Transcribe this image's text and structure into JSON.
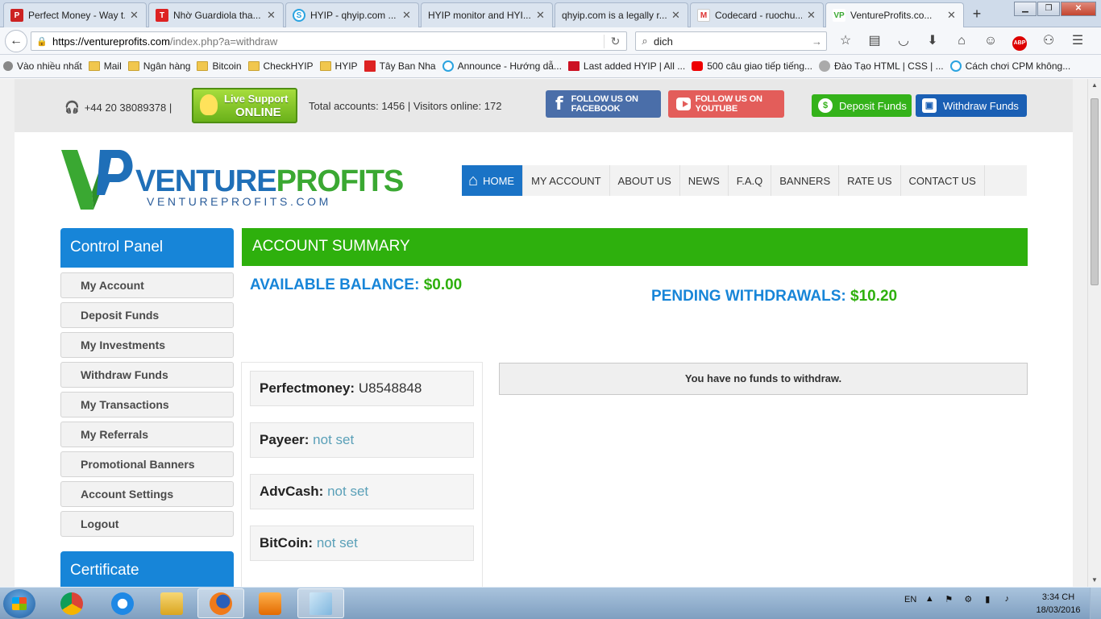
{
  "browser": {
    "tabs": [
      {
        "label": "Perfect Money - Way t...",
        "icon": "perfectmoney-icon"
      },
      {
        "label": "Nhờ Guardiola tha...",
        "icon": "news-t-icon"
      },
      {
        "label": "HYIP - qhyip.com ...",
        "icon": "qhyip-icon"
      },
      {
        "label": "HYIP monitor and HYI...",
        "icon": "blank-page-icon"
      },
      {
        "label": "qhyip.com is a legally r...",
        "icon": "blank-page-icon"
      },
      {
        "label": "Codecard - ruochu...",
        "icon": "gmail-icon"
      },
      {
        "label": "VentureProfits.co...",
        "icon": "ventureprofits-icon"
      }
    ],
    "url_host": "https://ventureprofits.com",
    "url_path": "/index.php?a=withdraw",
    "search_value": "dich",
    "bookmarks": [
      {
        "label": "Vào nhiều nhất",
        "icon": "gear-icon"
      },
      {
        "label": "Mail",
        "icon": "folder-icon"
      },
      {
        "label": "Ngân hàng",
        "icon": "folder-icon"
      },
      {
        "label": "Bitcoin",
        "icon": "folder-icon"
      },
      {
        "label": "CheckHYIP",
        "icon": "folder-icon"
      },
      {
        "label": "HYIP",
        "icon": "folder-icon"
      },
      {
        "label": "Tây Ban Nha",
        "icon": "news-t-icon"
      },
      {
        "label": "Announce - Hướng dẫ...",
        "icon": "cpm-icon"
      },
      {
        "label": "Last added HYIP | All ...",
        "icon": "a-icon"
      },
      {
        "label": "500 câu giao tiếp tiếng...",
        "icon": "youtube-icon"
      },
      {
        "label": "Đào Tạo HTML | CSS | ...",
        "icon": "globe-icon"
      },
      {
        "label": "Cách chơi CPM không...",
        "icon": "cpm-icon"
      }
    ]
  },
  "site": {
    "phone": "+44 20 38089378 |",
    "live_support": {
      "line1": "Live Support",
      "line2": "ONLINE"
    },
    "stats": "Total accounts:   1456 | Visitors online:   172",
    "facebook_label": "FOLLOW US ON FACEBOOK",
    "youtube_label": "FOLLOW US ON YOUTUBE",
    "deposit_label": "Deposit Funds",
    "withdraw_label": "Withdraw Funds",
    "logo": {
      "brand_a": "VENTURE",
      "brand_b": "PROFITS",
      "sub": "VENTUREPROFITS.COM"
    },
    "menu": [
      "HOME",
      "MY ACCOUNT",
      "ABOUT US",
      "NEWS",
      "F.A.Q",
      "BANNERS",
      "RATE US",
      "CONTACT US"
    ],
    "control_panel_title": "Control Panel",
    "sidebar": [
      "My Account",
      "Deposit Funds",
      "My Investments",
      "Withdraw Funds",
      "My Transactions",
      "My Referrals",
      "Promotional Banners",
      "Account Settings",
      "Logout"
    ],
    "certificate_title": "Certificate",
    "account_summary_title": "ACCOUNT SUMMARY",
    "available_balance_label": "AVAILABLE BALANCE:",
    "available_balance_value": "$0.00",
    "pending_label": "PENDING WITHDRAWALS:",
    "pending_value": "$10.20",
    "wallets": [
      {
        "label": "Perfectmoney:",
        "value": "U8548848",
        "set": true
      },
      {
        "label": "Payeer:",
        "value": "not set",
        "set": false
      },
      {
        "label": "AdvCash:",
        "value": "not set",
        "set": false
      },
      {
        "label": "BitCoin:",
        "value": "not set",
        "set": false
      }
    ],
    "no_funds_message": "You have no funds to withdraw.",
    "colors": {
      "blue": "#1785d8",
      "green": "#2eb00d",
      "notset": "#5aa0b8"
    }
  },
  "taskbar": {
    "apps": [
      "chrome-icon",
      "ie-icon",
      "explorer-icon",
      "firefox-icon",
      "media-player-icon",
      "notepad-icon"
    ],
    "lang": "EN",
    "time": "3:34 CH",
    "date": "18/03/2016"
  }
}
